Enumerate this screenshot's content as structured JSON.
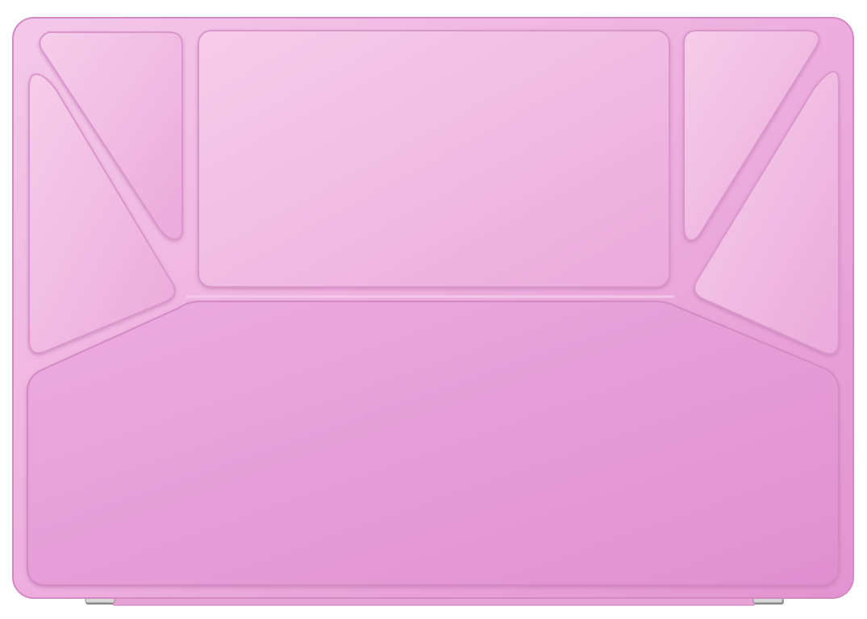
{
  "product": {
    "name": "",
    "description": ""
  },
  "colors": {
    "background": "#ffffff",
    "cover_light": "#f2c2e6",
    "cover_mid": "#eaa8da",
    "cover_dark": "#dd8fcb",
    "edge": "#c979b8",
    "crease_shadow": "#d592c6",
    "crease_highlight": "#f7d6ef",
    "hinge_metal": "#cfcfcf",
    "hinge_dark": "#8e8e8e"
  },
  "panels": [
    {
      "id": "top-left-triangle-back",
      "label": ""
    },
    {
      "id": "top-left-triangle-front",
      "label": ""
    },
    {
      "id": "top-center-rectangle",
      "label": ""
    },
    {
      "id": "top-right-triangle-back",
      "label": ""
    },
    {
      "id": "top-right-triangle-front",
      "label": ""
    },
    {
      "id": "bottom-large-panel",
      "label": ""
    }
  ]
}
